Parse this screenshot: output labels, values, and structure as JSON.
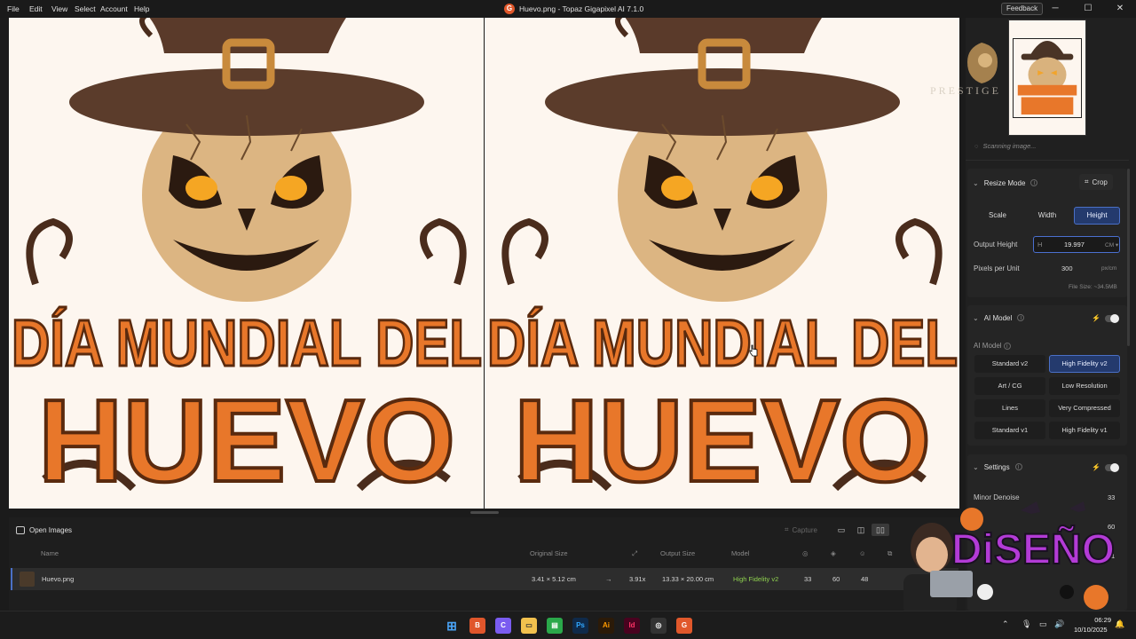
{
  "menu": [
    "File",
    "Edit",
    "View",
    "Select",
    "Account",
    "Help"
  ],
  "window": {
    "title": "Huevo.png - Topaz Gigapixel AI 7.1.0",
    "feedback": "Feedback",
    "minimize": "─",
    "maximize": "☐",
    "close": "✕"
  },
  "viewer": {
    "line1": "DÍA MUNDIAL DEL",
    "line2": "HUEVO"
  },
  "panel": {
    "scanning": "Scanning image...",
    "resize": {
      "title": "Resize Mode",
      "crop": "Crop",
      "tabs": [
        "Scale",
        "Width",
        "Height"
      ],
      "active_tab": "Height",
      "output_height_label": "Output Height",
      "height_prefix": "H",
      "height_value": "19.997",
      "height_unit": "CM ▾",
      "ppu_label": "Pixels per Unit",
      "ppu_value": "300",
      "ppu_unit": "px/cm",
      "file_size": "File Size: ~34.5MB"
    },
    "ai_model": {
      "title": "AI Model",
      "sub_label": "AI Model",
      "models": [
        "Standard v2",
        "High Fidelity v2",
        "Art / CG",
        "Low Resolution",
        "Lines",
        "Very Compressed",
        "Standard v1",
        "High Fidelity v1"
      ],
      "active": "High Fidelity v2"
    },
    "settings": {
      "title": "Settings",
      "minor_denoise_label": "Minor Denoise",
      "values": [
        "33",
        "60",
        "1"
      ]
    },
    "watermark": "PRESTIGE"
  },
  "bottom": {
    "open_images": "Open Images",
    "capture": "Capture",
    "columns": {
      "name": "Name",
      "original": "Original Size",
      "output": "Output Size",
      "model": "Model"
    },
    "row": {
      "name": "Huevo.png",
      "original": "3.41 × 5.12 cm",
      "arrow": "→",
      "scale": "3.91x",
      "output": "13.33 × 20.00 cm",
      "model": "High Fidelity v2",
      "v1": "33",
      "v2": "60",
      "v3": "48"
    }
  },
  "taskbar": {
    "time": "06:29",
    "date": "10/10/2025"
  },
  "sticker": {
    "text": "DiSEÑO"
  },
  "colors": {
    "accent": "#4a70c7",
    "model_green": "#8fd14f",
    "pumpkin": "#e8772a"
  }
}
